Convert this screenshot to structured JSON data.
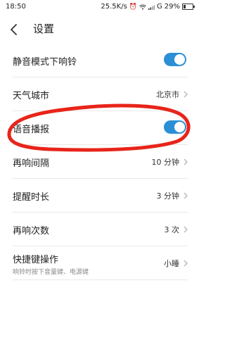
{
  "status_bar": {
    "time": "18:50",
    "network_speed": "25.5K/s",
    "signal_label": "G",
    "battery": "29%",
    "battery_level": 0.29,
    "icons": [
      "alarm-icon",
      "wifi-icon",
      "signal-icon",
      "battery-icon"
    ]
  },
  "header": {
    "title": "设置",
    "back_icon": "chevron-left-icon"
  },
  "settings": {
    "items": [
      {
        "label": "静音模式下响铃",
        "type": "toggle",
        "on": true
      },
      {
        "label": "天气城市",
        "type": "value",
        "value": "北京市"
      },
      {
        "label": "语音播报",
        "type": "toggle",
        "on": true
      },
      {
        "label": "再响间隔",
        "type": "value",
        "value": "10 分钟"
      },
      {
        "label": "提醒时长",
        "type": "value",
        "value": "3 分钟"
      },
      {
        "label": "再响次数",
        "type": "value",
        "value": "3 次"
      },
      {
        "label": "快捷键操作",
        "type": "value",
        "value": "小睡",
        "sublabel": "响铃时按下音量键、电源键"
      }
    ]
  },
  "colors": {
    "toggle_on": "#2b8fd6",
    "annotation": "#e8241a",
    "divider": "#e8e8e8"
  }
}
